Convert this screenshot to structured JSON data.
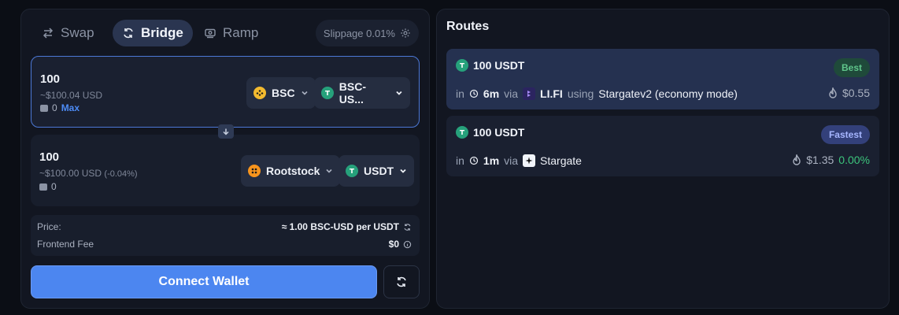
{
  "tabs": [
    {
      "label": "Swap",
      "icon": "swap-arrows-icon"
    },
    {
      "label": "Bridge",
      "icon": "bridge-cycle-icon"
    },
    {
      "label": "Ramp",
      "icon": "ramp-card-icon"
    }
  ],
  "slippage": {
    "label": "Slippage 0.01%",
    "icon": "gear-icon"
  },
  "from": {
    "amount": "100",
    "usd": "~$100.04 USD",
    "balance": "0",
    "max_label": "Max",
    "chain": {
      "label": "BSC",
      "color": "#f3ba2f"
    },
    "token": {
      "label": "BSC-US...",
      "color": "#26a17b"
    }
  },
  "to": {
    "amount": "100",
    "usd": "~$100.00 USD",
    "usd_change": "(-0.04%)",
    "balance": "0",
    "chain": {
      "label": "Rootstock",
      "color": "#f7941d"
    },
    "token": {
      "label": "USDT",
      "color": "#26a17b"
    }
  },
  "info": {
    "price_label": "Price:",
    "price_value": "≈ 1.00 BSC-USD per USDT",
    "fee_label": "Frontend Fee",
    "fee_value": "$0"
  },
  "actions": {
    "connect_label": "Connect Wallet"
  },
  "routes": {
    "title": "Routes",
    "items": [
      {
        "amount": "100 USDT",
        "badge": "Best",
        "in_label": "in",
        "time": "6m",
        "via_label": "via",
        "provider": "LI.FI",
        "using_label": "using",
        "bridge": "Stargatev2 (economy mode)",
        "gas": "$0.55",
        "pct": ""
      },
      {
        "amount": "100 USDT",
        "badge": "Fastest",
        "in_label": "in",
        "time": "1m",
        "via_label": "via",
        "provider": "Stargate",
        "gas": "$1.35",
        "pct": "0.00%"
      }
    ]
  },
  "colors": {
    "accent": "#4c86f0",
    "positive": "#3cc47c",
    "usdt": "#26a17b"
  }
}
